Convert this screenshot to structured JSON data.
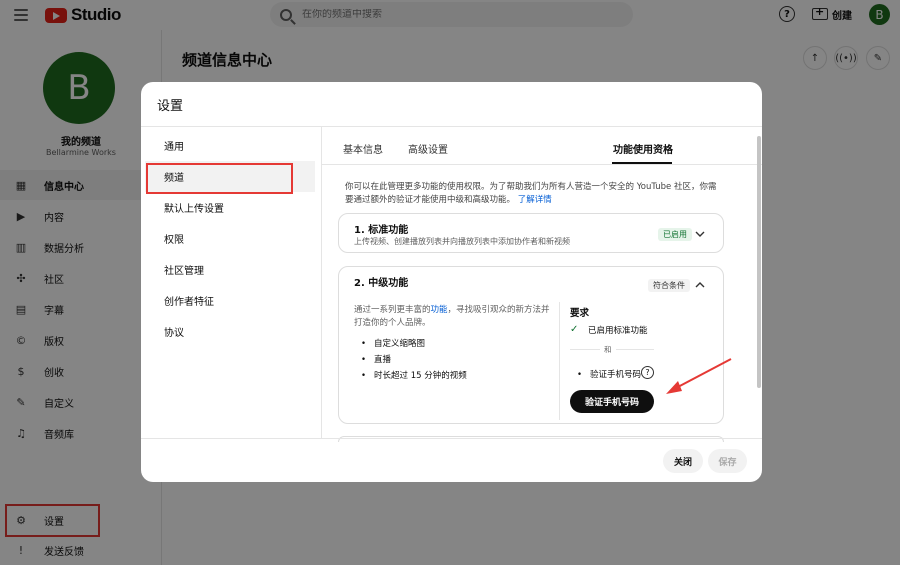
{
  "app": {
    "logo_text": "Studio",
    "create_label": "创建",
    "avatar_letter": "B"
  },
  "search": {
    "placeholder": "在你的频道中搜索"
  },
  "channel": {
    "avatar_letter": "B",
    "name": "我的频道",
    "handle": "Bellarmine Works"
  },
  "sidebar": {
    "items": [
      {
        "label": "信息中心",
        "icon": "dashboard-icon",
        "glyph": "▦"
      },
      {
        "label": "内容",
        "icon": "content-icon",
        "glyph": "▶"
      },
      {
        "label": "数据分析",
        "icon": "analytics-icon",
        "glyph": "▥"
      },
      {
        "label": "社区",
        "icon": "community-icon",
        "glyph": "✣"
      },
      {
        "label": "字幕",
        "icon": "subtitles-icon",
        "glyph": "▤"
      },
      {
        "label": "版权",
        "icon": "copyright-icon",
        "glyph": "©"
      },
      {
        "label": "创收",
        "icon": "earn-icon",
        "glyph": "$"
      },
      {
        "label": "自定义",
        "icon": "customization-icon",
        "glyph": "✎"
      },
      {
        "label": "音频库",
        "icon": "audio-library-icon",
        "glyph": "♫"
      }
    ],
    "bottom": [
      {
        "label": "设置",
        "icon": "gear-icon",
        "glyph": "⚙"
      },
      {
        "label": "发送反馈",
        "icon": "feedback-icon",
        "glyph": "!"
      }
    ]
  },
  "main": {
    "title": "频道信息中心"
  },
  "dialog": {
    "title": "设置",
    "nav": [
      "通用",
      "频道",
      "默认上传设置",
      "权限",
      "社区管理",
      "创作者特征",
      "协议"
    ],
    "tabs": [
      "基本信息",
      "高级设置",
      "功能使用资格"
    ],
    "intro_line1": "你可以在此管理更多功能的使用权限。为了帮助我们为所有人营造一个安全的 YouTube 社区，你需",
    "intro_line2": "要通过额外的验证才能使用中级和高级功能。",
    "learn_more": "了解详情",
    "standard": {
      "title": "1. 标准功能",
      "desc": "上传视频、创建播放列表并向播放列表中添加协作者和新视频",
      "badge": "已启用"
    },
    "intermediate": {
      "title": "2. 中级功能",
      "badge": "符合条件",
      "desc_before": "通过一系列更丰富的",
      "desc_link": "功能",
      "desc_after": "，寻找吸引观众的新方法并打造你的个人品牌。",
      "bullets": [
        "自定义缩略图",
        "直播",
        "时长超过 15 分钟的视频"
      ],
      "req_title": "要求",
      "req_done": "已启用标准功能",
      "and": "和",
      "req_pending": "验证手机号码",
      "verify_button": "验证手机号码"
    },
    "close_button": "关闭",
    "save_button": "保存"
  },
  "colors": {
    "highlight": "#e53935",
    "link": "#065fd4",
    "enabled_badge": "#137333",
    "brand": "#e62117"
  }
}
